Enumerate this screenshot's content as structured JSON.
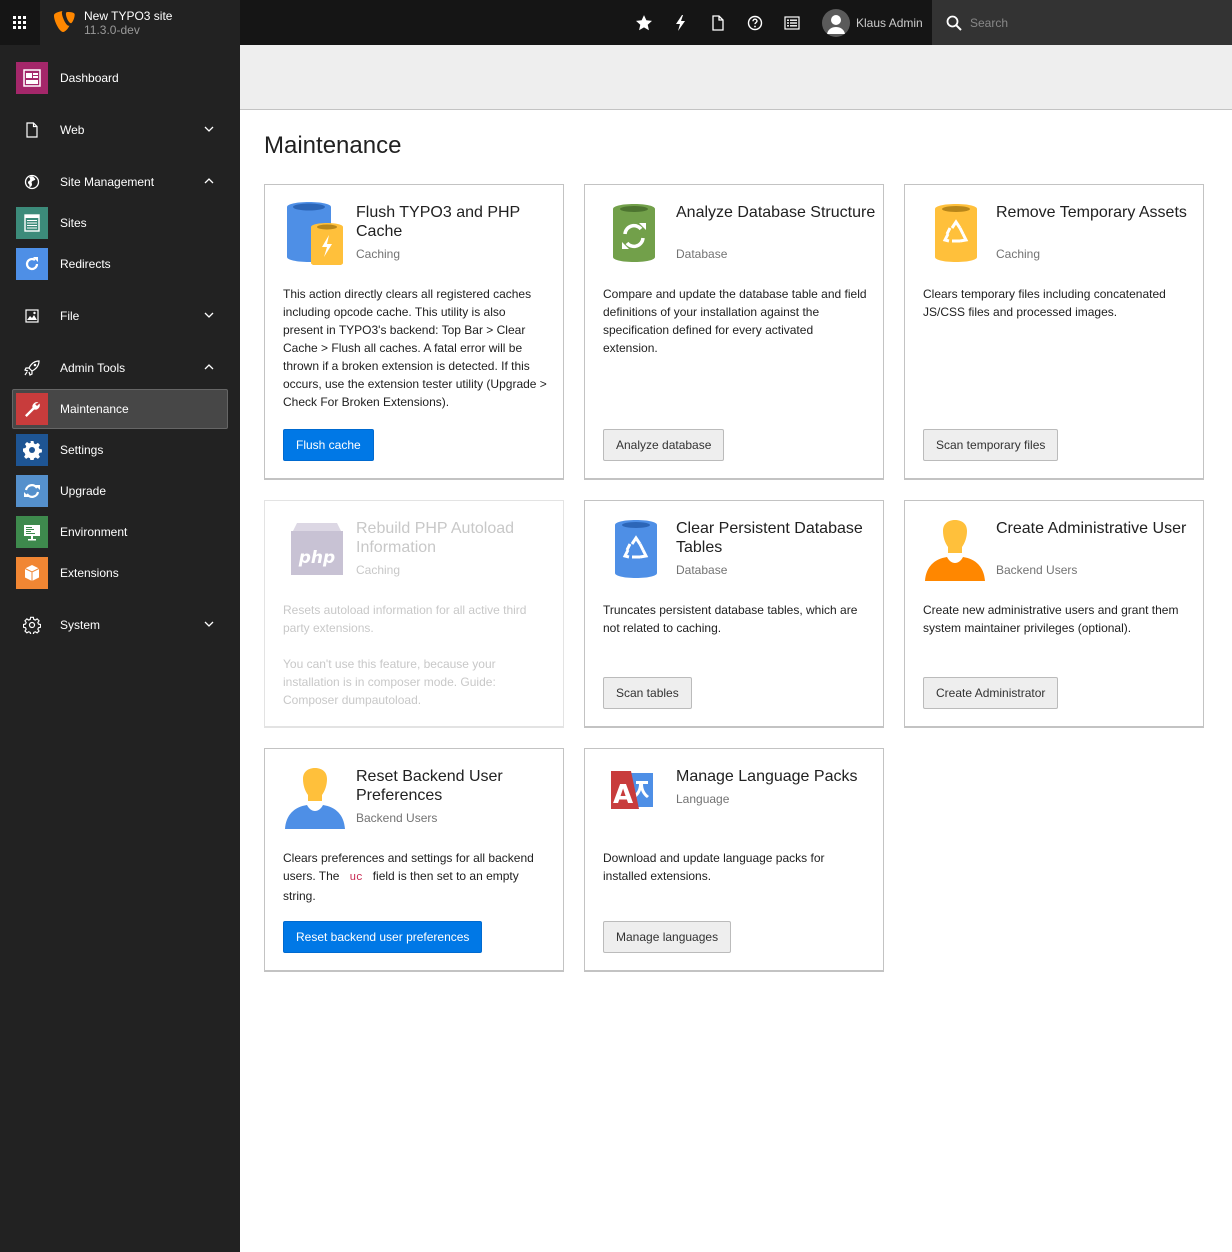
{
  "topbar": {
    "site_name": "New TYPO3 site",
    "version": "11.3.0-dev",
    "icons": [
      "bookmark-star-icon",
      "flash-icon",
      "document-icon",
      "help-icon",
      "list-icon"
    ],
    "user_name": "Klaus Admin",
    "search_placeholder": "Search"
  },
  "sidebar": {
    "dashboard": "Dashboard",
    "web": "Web",
    "site_management": "Site Management",
    "sites": "Sites",
    "redirects": "Redirects",
    "file": "File",
    "admin_tools": "Admin Tools",
    "maintenance": "Maintenance",
    "settings": "Settings",
    "upgrade": "Upgrade",
    "environment": "Environment",
    "extensions": "Extensions",
    "system": "System"
  },
  "page": {
    "title": "Maintenance"
  },
  "cards": {
    "flush": {
      "title": "Flush TYPO3 and PHP Cache",
      "subtitle": "Caching",
      "body": "This action directly clears all registered caches including opcode cache. This utility is also present in TYPO3's backend: Top Bar > Clear Cache > Flush all caches. A fatal error will be thrown if a broken extension is detected. If this occurs, use the extension tester utility (Upgrade > Check For Broken Extensions).",
      "button": "Flush cache"
    },
    "analyze": {
      "title": "Analyze Database Structure",
      "subtitle": "Database",
      "body": "Compare and update the database table and field definitions of your installation against the specification defined for every activated extension.",
      "button": "Analyze database"
    },
    "temp": {
      "title": "Remove Temporary Assets",
      "subtitle": "Caching",
      "body": "Clears temporary files including concatenated JS/CSS files and processed images.",
      "button": "Scan temporary files"
    },
    "autoload": {
      "title": "Rebuild PHP Autoload Information",
      "subtitle": "Caching",
      "body": "Resets autoload information for all active third party extensions.",
      "note": "You can't use this feature, because your installation is in composer mode. Guide: Composer dumpautoload.",
      "icon_text": "php"
    },
    "persistent": {
      "title": "Clear Persistent Database Tables",
      "subtitle": "Database",
      "body": "Truncates persistent database tables, which are not related to caching.",
      "button": "Scan tables"
    },
    "admin": {
      "title": "Create Administrative User",
      "subtitle": "Backend Users",
      "body": "Create new administrative users and grant them system maintainer privileges (optional).",
      "button": "Create Administrator"
    },
    "reset": {
      "title": "Reset Backend User Preferences",
      "subtitle": "Backend Users",
      "body_before": "Clears preferences and settings for all backend users. The",
      "body_code": "uc",
      "body_after": "field is then set to an empty string.",
      "button": "Reset backend user preferences"
    },
    "language": {
      "title": "Manage Language Packs",
      "subtitle": "Language",
      "body": "Download and update language packs for installed extensions.",
      "button": "Manage languages"
    }
  }
}
